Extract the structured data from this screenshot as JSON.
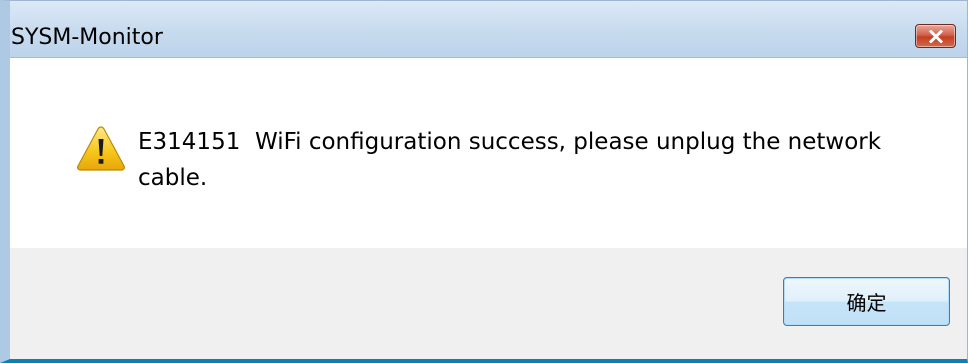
{
  "window": {
    "title": "SYSM-Monitor"
  },
  "dialog": {
    "icon": "warning-icon",
    "message": "E314151  WiFi configuration success, please unplug the network\ncable."
  },
  "buttons": {
    "ok_label": "确定",
    "close_icon": "close-icon"
  },
  "colors": {
    "close_button": "#c9472a",
    "ok_button_border": "#3c7fb1",
    "footer_bg": "#f0f0f0",
    "warning_fill": "#f5c518"
  }
}
